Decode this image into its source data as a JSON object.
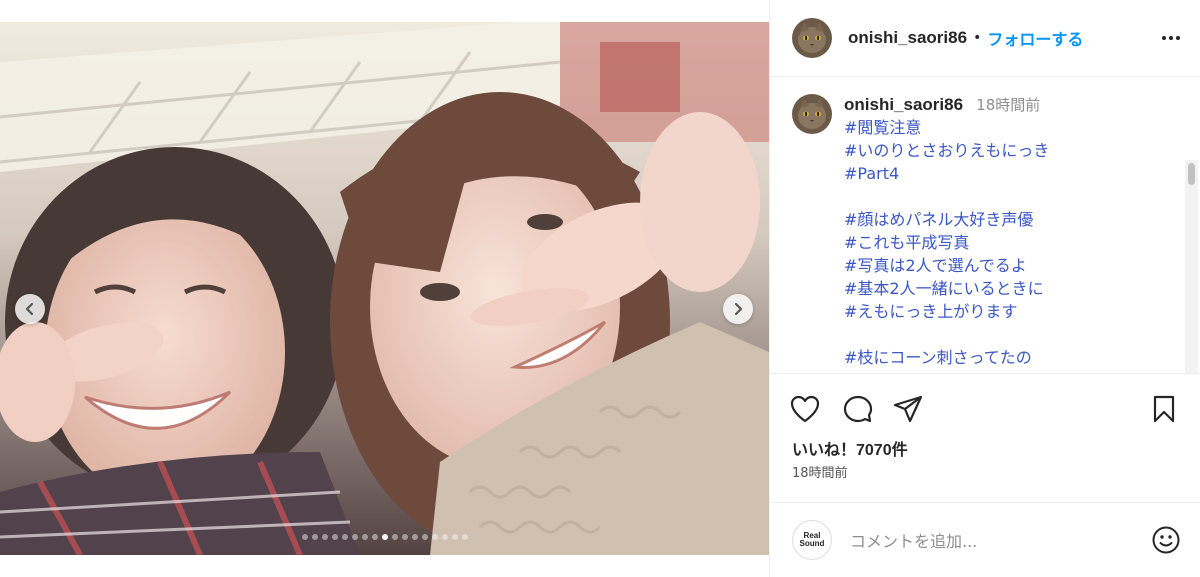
{
  "post": {
    "username": "onishi_saori86",
    "follow_label": "フォローする",
    "separator": "•"
  },
  "caption": {
    "username": "onishi_saori86",
    "time": "18時間前",
    "lines": [
      "#閲覧注意",
      "#いのりとさおりえもにっき",
      "#Part4",
      "",
      "#顔はめパネル大好き声優",
      "#これも平成写真",
      "#写真は2人で選んでるよ",
      "#基本2人一緒にいるときに",
      "#えもにっき上がります",
      "",
      "#枝にコーン刺さってたの"
    ]
  },
  "stats": {
    "likes": "いいね！7070件",
    "time": "18時間前"
  },
  "comment": {
    "placeholder": "コメントを追加...",
    "logo_line1": "Real",
    "logo_line2": "Sound"
  },
  "carousel": {
    "total": 17,
    "active": 9
  },
  "icons": {
    "more": "more-horizontal-icon",
    "prev": "chevron-left-icon",
    "next": "chevron-right-icon",
    "like": "heart-icon",
    "comment": "comment-bubble-icon",
    "share": "paper-plane-icon",
    "save": "bookmark-icon",
    "emoji": "smiley-icon"
  },
  "colors": {
    "accent": "#0095f6",
    "hashtag": "#3a57c4",
    "muted": "#8e8e8e"
  }
}
